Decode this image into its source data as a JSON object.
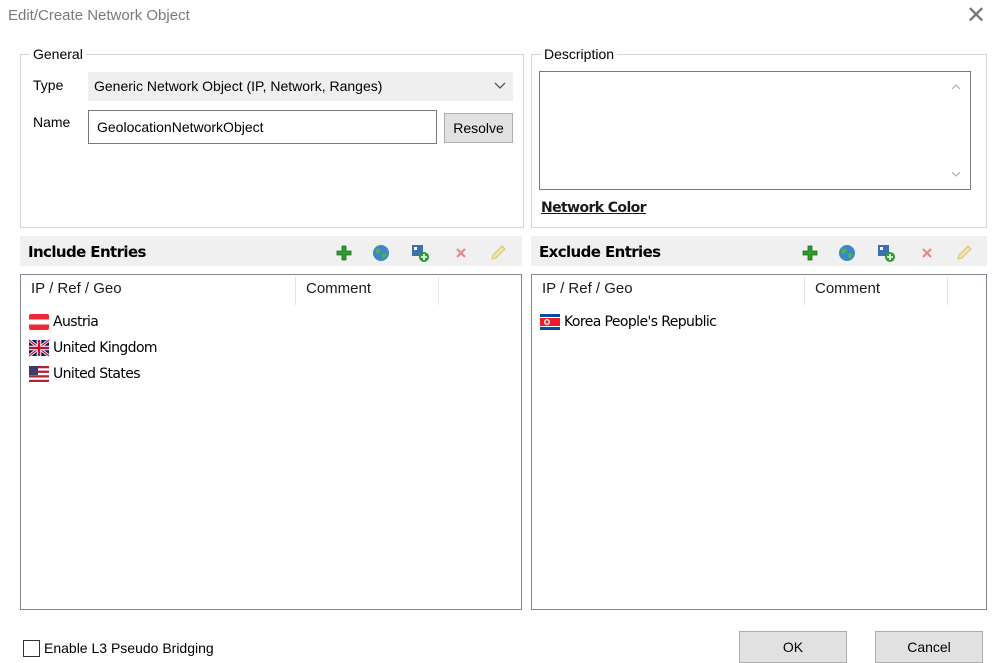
{
  "window": {
    "title": "Edit/Create Network Object"
  },
  "general": {
    "legend": "General",
    "type_label": "Type",
    "type_value": "Generic Network Object (IP, Network, Ranges)",
    "name_label": "Name",
    "name_value": "GeolocationNetworkObject",
    "resolve_label": "Resolve"
  },
  "description": {
    "legend": "Description",
    "value": "",
    "network_color_link": "Network Color"
  },
  "include": {
    "title": "Include Entries",
    "columns": [
      "IP / Ref / Geo",
      "Comment"
    ],
    "rows": [
      {
        "label": "Austria",
        "flag": "austria-flag-icon"
      },
      {
        "label": "United Kingdom",
        "flag": "uk-flag-icon"
      },
      {
        "label": "United States",
        "flag": "us-flag-icon"
      }
    ]
  },
  "exclude": {
    "title": "Exclude Entries",
    "columns": [
      "IP / Ref / Geo",
      "Comment"
    ],
    "rows": [
      {
        "label": "Korea People's Republic",
        "flag": "north-korea-flag-icon"
      }
    ]
  },
  "toolbar_icons": [
    "add-icon",
    "globe-icon",
    "add-object-icon",
    "delete-icon",
    "edit-pencil-icon"
  ],
  "footer": {
    "checkbox_label": "Enable L3 Pseudo Bridging",
    "checkbox_checked": false,
    "ok_label": "OK",
    "cancel_label": "Cancel"
  },
  "colors": {
    "border": "#d5d5d5",
    "header_bg": "#f0f0f0",
    "add_green": "#2e9b2e",
    "delete_red": "#e07070"
  }
}
